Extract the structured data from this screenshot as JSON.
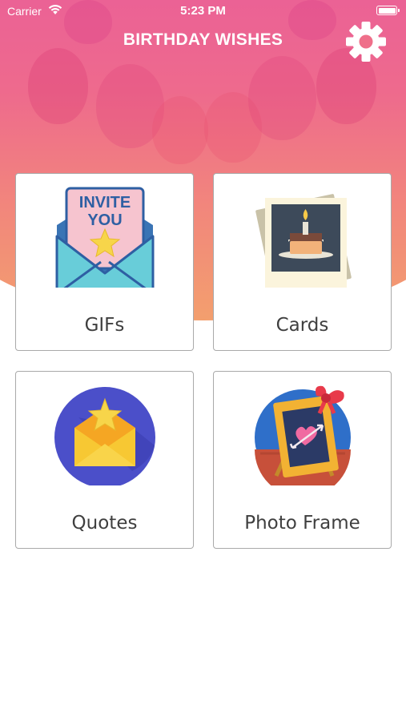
{
  "status_bar": {
    "carrier": "Carrier",
    "time": "5:23 PM"
  },
  "header": {
    "title": "BIRTHDAY WISHES",
    "settings_icon": "gear-icon"
  },
  "colors": {
    "gradient_top": "#ea5f98",
    "gradient_bottom": "#f39f6e",
    "card_border": "#a9a9a9",
    "label_text": "#3f3f3f"
  },
  "menu": {
    "items": [
      {
        "label": "GIFs",
        "icon": "invite-envelope-icon",
        "icon_text_1": "INVITE",
        "icon_text_2": "YOU"
      },
      {
        "label": "Cards",
        "icon": "birthday-cake-photo-icon"
      },
      {
        "label": "Quotes",
        "icon": "star-envelope-icon"
      },
      {
        "label": "Photo Frame",
        "icon": "heart-photo-frame-icon"
      }
    ]
  }
}
